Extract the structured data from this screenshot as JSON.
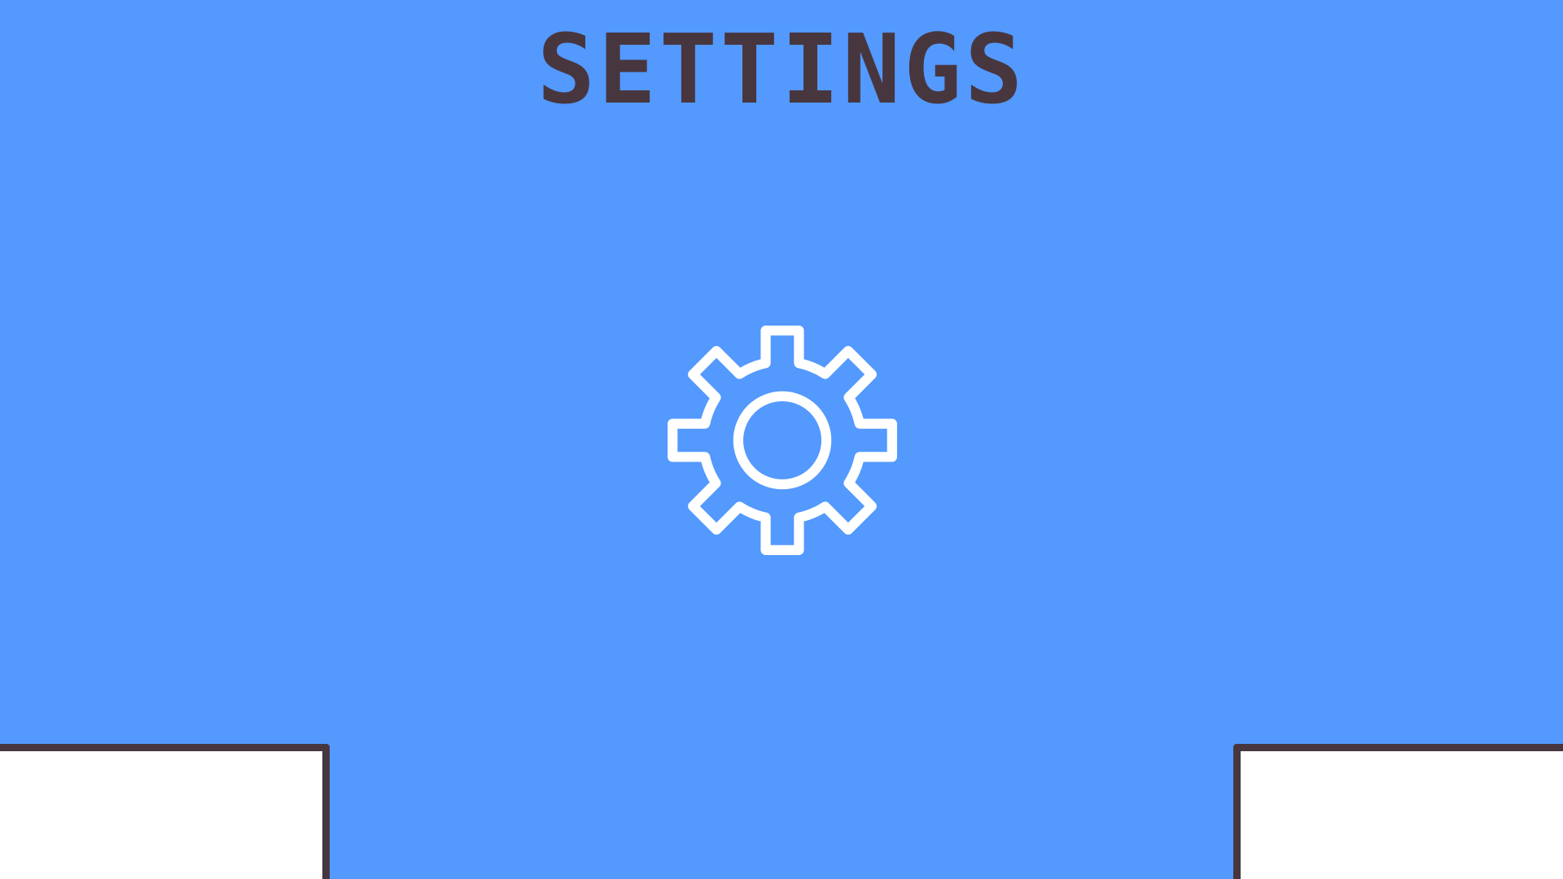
{
  "screen": {
    "title": "SETTINGS",
    "background_color": "#5399FE",
    "title_color": "#48363F"
  },
  "center_icon": {
    "icon": "gear-icon",
    "color": "#FFFFFF"
  },
  "panels": {
    "left_icon": "panel-left",
    "right_icon": "panel-right",
    "fill_color": "#FFFFFF",
    "border_color": "#48363F"
  }
}
